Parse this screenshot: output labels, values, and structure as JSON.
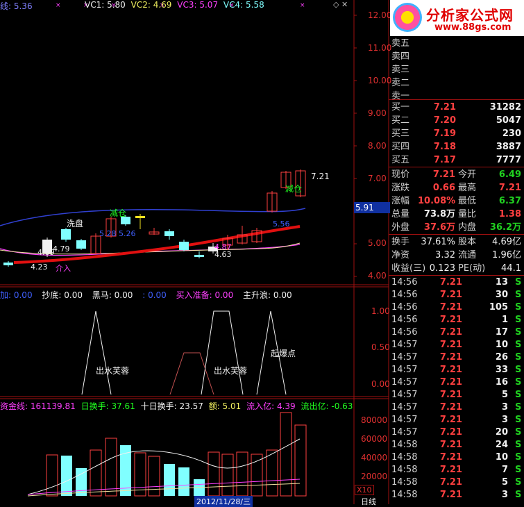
{
  "header": {
    "ma_label": "线: 5.36",
    "vc1": "VC1: 5.80",
    "vc2": "VC2: 4.69",
    "vc3": "VC3: 5.07",
    "vc4": "VC4: 5.58"
  },
  "price_axis": [
    "12.00",
    "11.00",
    "10.00",
    "9.00",
    "8.00",
    "7.00",
    "6.00",
    "5.00",
    "4.00"
  ],
  "current_price_tag": "5.91",
  "price_annotations": {
    "high": "7.21",
    "xipan": "洗盘",
    "jiancang1": "减仓",
    "jiancang2": "减仓",
    "v_5_28": "5.28",
    "v_5_26": "5.26",
    "v_5_56": "5.56",
    "v_4_69": "4.69",
    "v_4_79": "4.79",
    "v_4_23": "4.23",
    "v_4_87": "4.87",
    "v_4_63": "4.63",
    "jieru": "介入"
  },
  "indicator_legend": {
    "a": "加: 0.00",
    "b": "抄底: 0.00",
    "c": "黑马: 0.00",
    "d": ": 0.00",
    "e": "买入准备: 0.00",
    "f": "主升浪: 0.00"
  },
  "indicator_axis": [
    "1.00",
    "0.50",
    "0.00"
  ],
  "indicator_labels": [
    "出水芙蓉",
    "出水芙蓉",
    "起爆点"
  ],
  "volume_legend": {
    "a": "资金线: 161139.81",
    "b": "日换手: 37.61",
    "c": "十日换手: 23.57",
    "d": "额: 5.01",
    "e": "流入亿: 4.39",
    "f": "流出亿: -0.63"
  },
  "volume_axis": [
    "80000",
    "60000",
    "40000",
    "20000"
  ],
  "volume_unit": "X10",
  "date_label": "2012/11/28/三",
  "period_label": "日线",
  "logo": {
    "title": "分析家公式网",
    "url": "www.88gs.com"
  },
  "sell_orders": [
    {
      "name": "卖五",
      "price": "",
      "vol": ""
    },
    {
      "name": "卖四",
      "price": "",
      "vol": ""
    },
    {
      "name": "卖三",
      "price": "",
      "vol": ""
    },
    {
      "name": "卖二",
      "price": "",
      "vol": ""
    },
    {
      "name": "卖一",
      "price": "",
      "vol": ""
    }
  ],
  "buy_orders": [
    {
      "name": "买一",
      "price": "7.21",
      "vol": "31282"
    },
    {
      "name": "买二",
      "price": "7.20",
      "vol": "5047"
    },
    {
      "name": "买三",
      "price": "7.19",
      "vol": "230"
    },
    {
      "name": "买四",
      "price": "7.18",
      "vol": "3887"
    },
    {
      "name": "买五",
      "price": "7.17",
      "vol": "7777"
    }
  ],
  "stats": [
    {
      "l1": "现价",
      "v1": "7.21",
      "l2": "今开",
      "v2": "6.49",
      "c1": "#ff4040",
      "c2": "#20d020"
    },
    {
      "l1": "涨跌",
      "v1": "0.66",
      "l2": "最高",
      "v2": "7.21",
      "c1": "#ff4040",
      "c2": "#ff4040"
    },
    {
      "l1": "涨幅",
      "v1": "10.08%",
      "l2": "最低",
      "v2": "6.37",
      "c1": "#ff4040",
      "c2": "#20d020"
    },
    {
      "l1": "总量",
      "v1": "73.8万",
      "l2": "量比",
      "v2": "1.38",
      "c1": "#f0f0f0",
      "c2": "#ff4040"
    },
    {
      "l1": "外盘",
      "v1": "37.6万",
      "l2": "内盘",
      "v2": "36.2万",
      "c1": "#ff4040",
      "c2": "#20d020"
    }
  ],
  "stats2": [
    {
      "l1": "换手",
      "v1": "37.61%",
      "l2": "股本",
      "v2": "4.69亿"
    },
    {
      "l1": "净资",
      "v1": "3.32",
      "l2": "流通",
      "v2": "1.96亿"
    },
    {
      "l1": "收益(三)",
      "v1": "0.123",
      "l2": "PE(动)",
      "v2": "44.1"
    }
  ],
  "ticks": [
    {
      "t": "14:56",
      "p": "7.21",
      "v": "13",
      "s": "S"
    },
    {
      "t": "14:56",
      "p": "7.21",
      "v": "30",
      "s": "S"
    },
    {
      "t": "14:56",
      "p": "7.21",
      "v": "105",
      "s": "S"
    },
    {
      "t": "14:56",
      "p": "7.21",
      "v": "1",
      "s": "S"
    },
    {
      "t": "14:56",
      "p": "7.21",
      "v": "17",
      "s": "S"
    },
    {
      "t": "14:57",
      "p": "7.21",
      "v": "10",
      "s": "S"
    },
    {
      "t": "14:57",
      "p": "7.21",
      "v": "26",
      "s": "S"
    },
    {
      "t": "14:57",
      "p": "7.21",
      "v": "33",
      "s": "S"
    },
    {
      "t": "14:57",
      "p": "7.21",
      "v": "16",
      "s": "S"
    },
    {
      "t": "14:57",
      "p": "7.21",
      "v": "5",
      "s": "S"
    },
    {
      "t": "14:57",
      "p": "7.21",
      "v": "3",
      "s": "S"
    },
    {
      "t": "14:57",
      "p": "7.21",
      "v": "3",
      "s": "S"
    },
    {
      "t": "14:57",
      "p": "7.21",
      "v": "20",
      "s": "S"
    },
    {
      "t": "14:58",
      "p": "7.21",
      "v": "24",
      "s": "S"
    },
    {
      "t": "14:58",
      "p": "7.21",
      "v": "10",
      "s": "S"
    },
    {
      "t": "14:58",
      "p": "7.21",
      "v": "7",
      "s": "S"
    },
    {
      "t": "14:58",
      "p": "7.21",
      "v": "5",
      "s": "S"
    },
    {
      "t": "14:58",
      "p": "7.21",
      "v": "3",
      "s": "S"
    }
  ],
  "colors": {
    "up": "#ff4040",
    "down": "#20d020",
    "cyan": "#80ffff",
    "grid": "#a01010"
  }
}
